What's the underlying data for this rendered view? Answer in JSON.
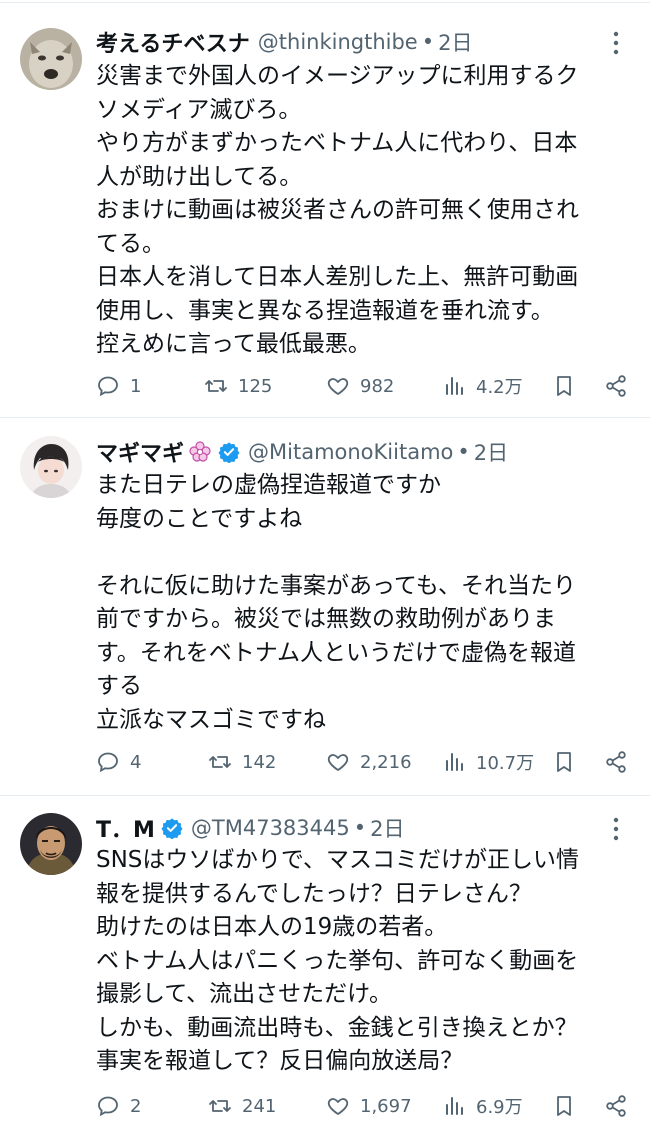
{
  "tweets": [
    {
      "name": "考えるチベスナ",
      "handle": "@thinkingthibe",
      "time": "2日",
      "verified": false,
      "lines": [
        "災害まで外国人のイメージアップに利用するク",
        "ソメディア滅びろ。",
        "やり方がまずかったベトナム人に代わり、日本",
        "人が助け出してる。",
        "おまけに動画は被災者さんの許可無く使用され",
        "てる。",
        "日本人を消して日本人差別した上、無許可動画",
        "使用し、事実と異なる捏造報道を垂れ流す。",
        "控えめに言って最低最悪。"
      ],
      "replies": "1",
      "retweets": "125",
      "likes": "982",
      "views": "4.2万"
    },
    {
      "name": "マギマギ",
      "handle": "@MitamonoKiitamo",
      "time": "2日",
      "verified": true,
      "lines": [
        "また日テレの虚偽捏造報道ですか",
        "毎度のことですよね",
        "",
        "それに仮に助けた事案があっても、それ当たり",
        "前ですから。被災では無数の救助例がありま",
        "す。それをベトナム人というだけで虚偽を報道",
        "する",
        "立派なマスゴミですね"
      ],
      "replies": "4",
      "retweets": "142",
      "likes": "2,216",
      "views": "10.7万"
    },
    {
      "name": "T．M",
      "handle": "@TM47383445",
      "time": "2日",
      "verified": true,
      "lines": [
        "SNSはウソばかりで、マスコミだけが正しい情",
        "報を提供するんでしたっけ？日テレさん？",
        "助けたのは日本人の19歳の若者。",
        "ベトナム人はパニくった挙句、許可なく動画を",
        "撮影して、流出させただけ。",
        "しかも、動画流出時も、金銭と引き換えとか？",
        "事実を報道して？反日偏向放送局？"
      ],
      "replies": "2",
      "retweets": "241",
      "likes": "1,697",
      "views": "6.9万"
    }
  ],
  "icons": {
    "reply": "reply-icon",
    "retweet": "retweet-icon",
    "like": "heart-icon",
    "views": "views-icon",
    "bookmark": "bookmark-icon",
    "share": "share-icon",
    "more": "more-icon",
    "verified": "verified-badge-icon"
  },
  "colors": {
    "text": "#0f1419",
    "secondary": "#536471",
    "verified": "#1d9bf0",
    "divider": "#e6ecf0"
  }
}
